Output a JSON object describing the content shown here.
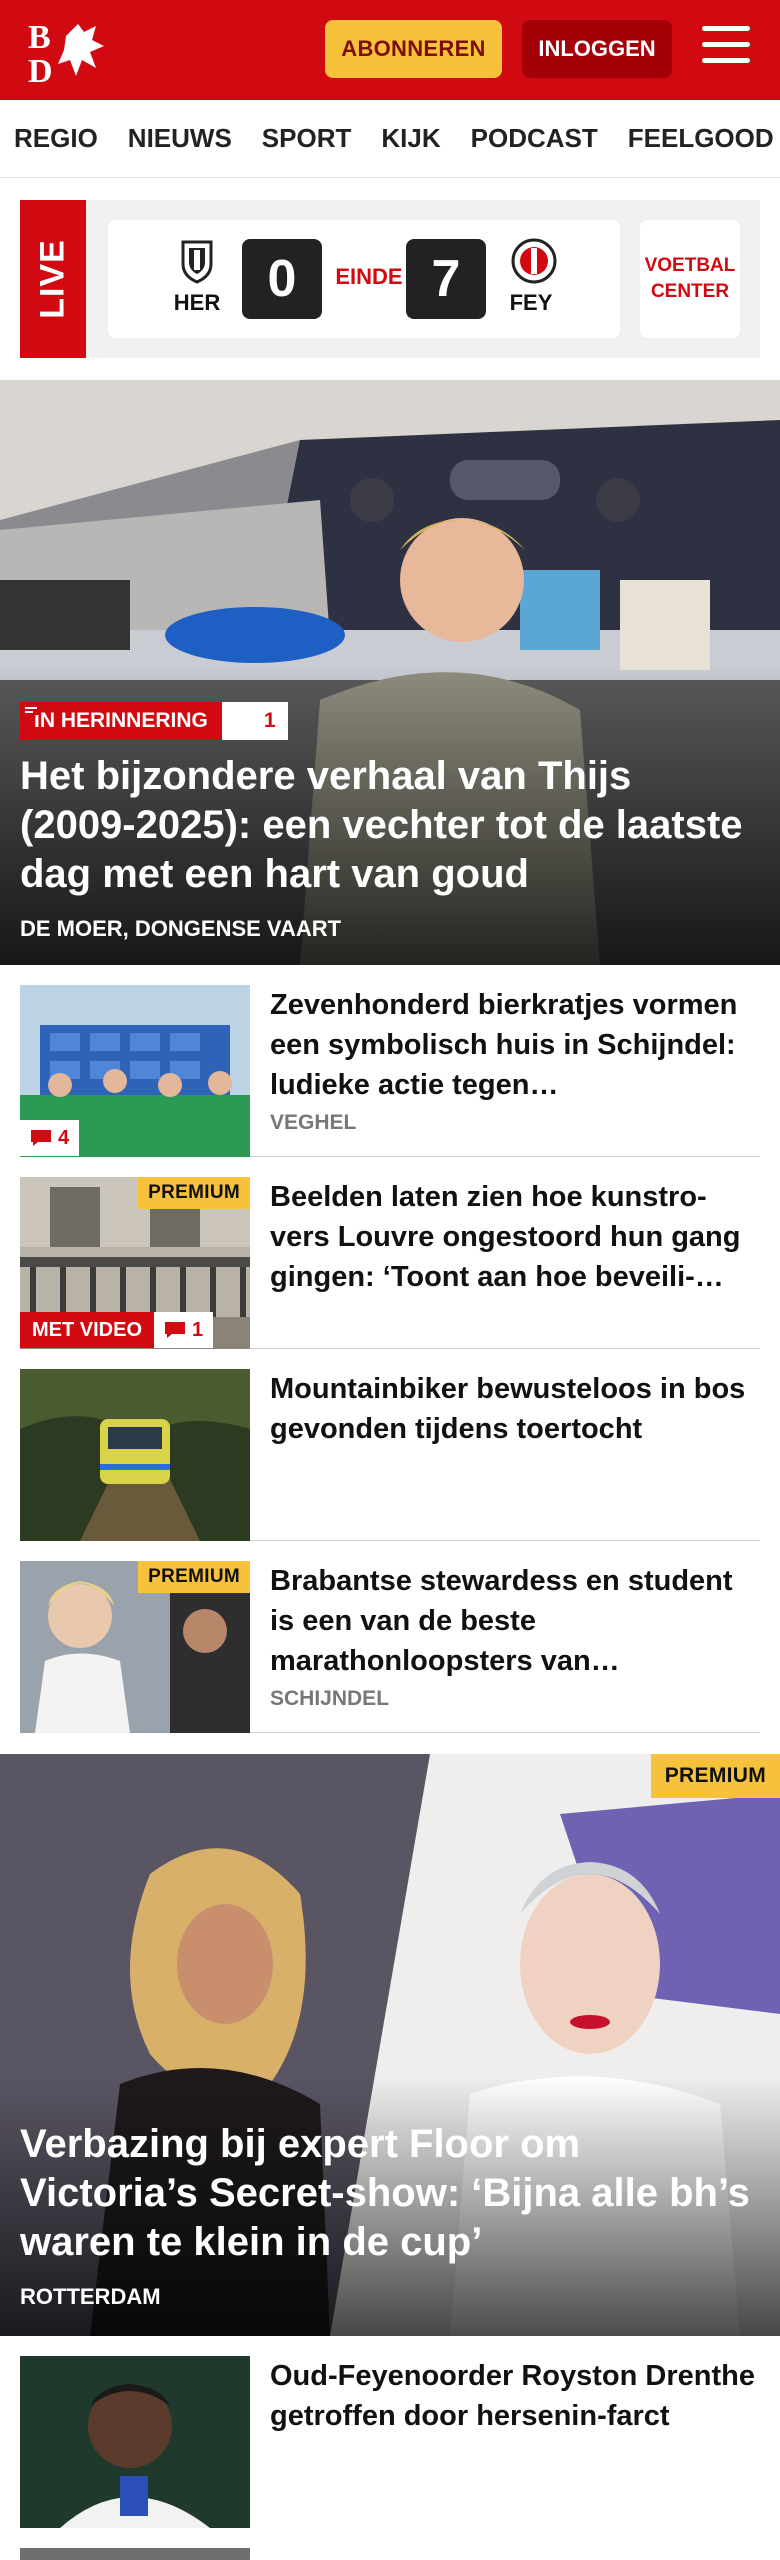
{
  "header": {
    "logo_text": "BD",
    "subscribe_label": "ABONNEREN",
    "login_label": "INLOGGEN"
  },
  "nav": {
    "items": [
      "REGIO",
      "NIEUWS",
      "SPORT",
      "KIJK",
      "PODCAST",
      "FEELGOOD"
    ]
  },
  "live": {
    "label": "LIVE",
    "home_team": "HER",
    "away_team": "FEY",
    "home_score": "0",
    "away_score": "7",
    "status": "EINDE",
    "voetbal_center": "VOETBAL CENTER"
  },
  "hero": {
    "tag": "IN HERINNERING",
    "comments": "1",
    "title": "Het bijzondere verhaal van Thijs (2009-2025): een vechter tot de laatste dag met een hart van goud",
    "location": "DE MOER, DONGENSE VAART"
  },
  "articles": [
    {
      "title": "Zevenhonderd bierkratjes vormen een symbolisch huis in Schijndel: ludieke actie tegen…",
      "location": "VEGHEL",
      "comments": "4",
      "premium": "",
      "video": ""
    },
    {
      "title": "Beelden laten zien hoe kunstro-vers Louvre ongestoord hun gang gingen: ‘Toont aan hoe beveili-…",
      "location": "",
      "comments": "1",
      "premium": "PREMIUM",
      "video": "MET VIDEO"
    },
    {
      "title": "Mountainbiker bewusteloos in bos gevonden tijdens toertocht",
      "location": "",
      "comments": "",
      "premium": "",
      "video": ""
    },
    {
      "title": "Brabantse stewardess en student is een van de beste marathonloopsters van…",
      "location": "SCHIJNDEL",
      "comments": "",
      "premium": "PREMIUM",
      "video": ""
    }
  ],
  "feature": {
    "premium": "PREMIUM",
    "title": "Verbazing bij expert Floor om Victoria’s Secret-show: ‘Bijna alle bh’s waren te klein in de cup’",
    "location": "ROTTERDAM"
  },
  "bottom_article": {
    "title": "Oud-Feyenoorder Royston Drenthe getroffen door hersenin-farct"
  },
  "colors": {
    "brand_red": "#d10a11",
    "premium_yellow": "#f6c23b",
    "dark_red": "#a3000a"
  }
}
